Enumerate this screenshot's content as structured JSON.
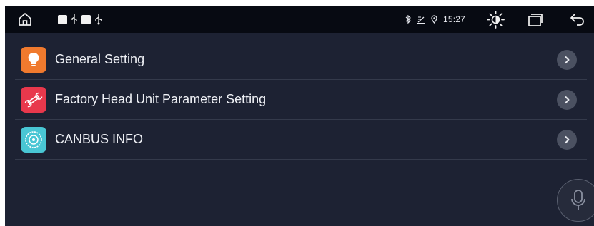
{
  "status_bar": {
    "time": "15:27",
    "icons": [
      "home-icon",
      "notification-square-icon",
      "usb-icon",
      "notification-square-icon",
      "usb-icon",
      "bluetooth-icon",
      "signal-blocked-icon",
      "location-icon",
      "brightness-icon",
      "recent-apps-icon",
      "back-icon"
    ]
  },
  "settings_list": {
    "items": [
      {
        "label": "General Setting",
        "icon": "lightbulb-icon",
        "icon_color": "#f07a2e"
      },
      {
        "label": "Factory Head Unit Parameter Setting",
        "icon": "wrench-icon",
        "icon_color": "#e8384c"
      },
      {
        "label": "CANBUS INFO",
        "icon": "canbus-icon",
        "icon_color": "#49c6d4"
      }
    ]
  },
  "voice": {
    "icon": "microphone-icon"
  },
  "colors": {
    "background": "#1d2233",
    "status_bar": "#070a12",
    "divider": "#343a4b",
    "chevron_bg": "#4b5161",
    "text": "#eef0f5"
  }
}
